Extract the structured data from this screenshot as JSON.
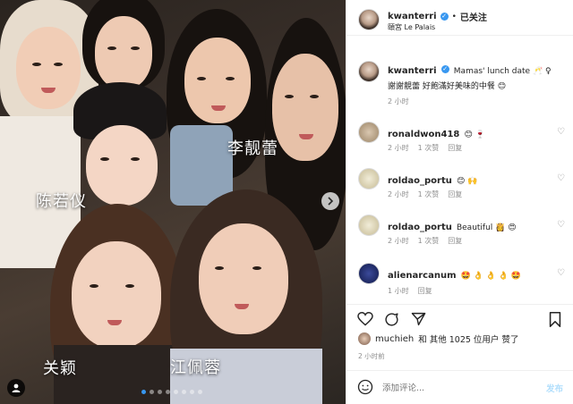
{
  "post": {
    "username": "kwanterri",
    "follow_status": "已关注",
    "dot_sep": "•",
    "location": "頤宮 Le Palais",
    "caption_user": "kwanterri",
    "caption_text": "Mamas' lunch date 🥂 ♀",
    "caption_text2": "謝謝靚蕾 好飽滿好美味的中餐 😊",
    "caption_time": "2 小时"
  },
  "photo": {
    "name_tags": [
      "李靓蕾",
      "陈若仪",
      "关颖",
      "江佩蓉"
    ],
    "carousel_dots": 8,
    "active_dot": 0
  },
  "comments": [
    {
      "user": "ronaldwon418",
      "text": "😊 🍷",
      "time": "2 小时",
      "likes": "1 次赞",
      "reply": "回复"
    },
    {
      "user": "roldao_portu",
      "text": "😊 🙌",
      "time": "2 小时",
      "likes": "1 次赞",
      "reply": "回复"
    },
    {
      "user": "roldao_portu",
      "text": "Beautiful 👸 😍",
      "time": "2 小时",
      "likes": "1 次赞",
      "reply": "回复"
    },
    {
      "user": "alienarcanum",
      "text": "🤩 👌 👌 👌 🤩",
      "time": "1 小时",
      "likes": "",
      "reply": "回复"
    }
  ],
  "actions": {
    "liked_by_user": "muchieh",
    "liked_by_text": "和 其他 1025 位用户 赞了",
    "time": "2 小时前"
  },
  "add_comment": {
    "placeholder": "添加评论...",
    "post_label": "发布"
  },
  "colors": {
    "accent": "#3897f0",
    "muted": "#8e8e8e",
    "text": "#262626"
  },
  "icons": [
    "heart-icon",
    "comment-icon",
    "share-icon",
    "bookmark-icon",
    "emoji-icon",
    "chevron-right-icon",
    "tagged-user-icon",
    "verified-badge-icon"
  ]
}
